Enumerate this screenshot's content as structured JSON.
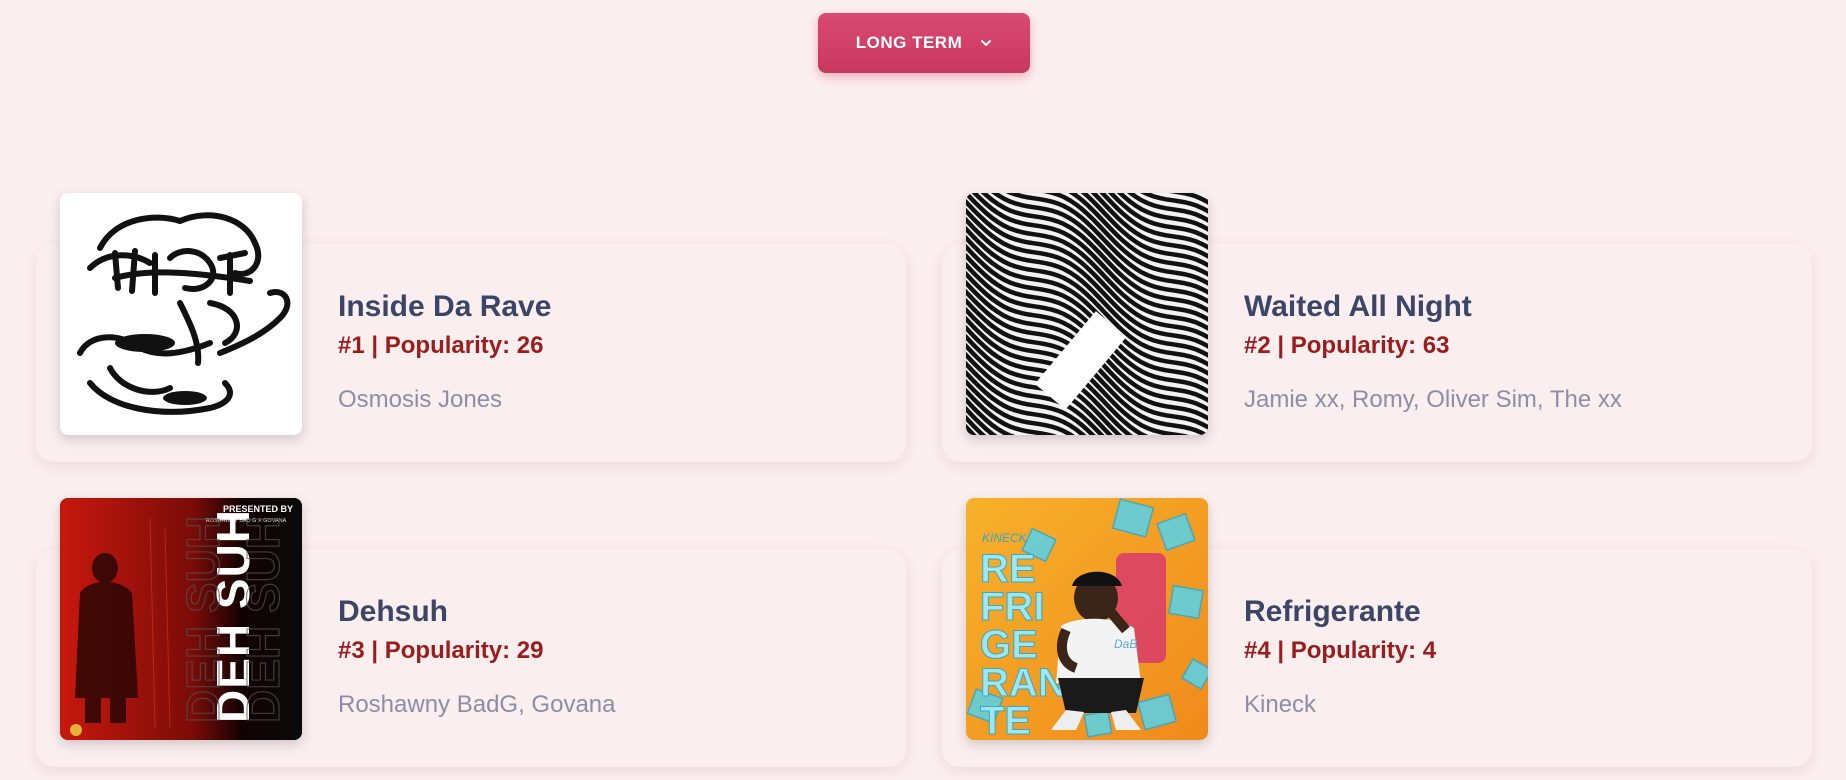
{
  "time_range": {
    "label": "LONG TERM",
    "icon": "chevron-down-icon"
  },
  "tracks": [
    {
      "title": "Inside Da Rave",
      "rank_text": "#1 | Popularity: 26",
      "artists": "Osmosis Jones",
      "cover_icon": "graffiti-cover"
    },
    {
      "title": "Waited All Night",
      "rank_text": "#2 | Popularity: 63",
      "artists": "Jamie xx, Romy, Oliver Sim, The xx",
      "cover_icon": "wave-pattern-cover"
    },
    {
      "title": "Dehsuh",
      "rank_text": "#3 | Popularity: 29",
      "artists": "Roshawny BadG, Govana",
      "cover_icon": "dehsuh-cover",
      "cover_text": {
        "top": "PRESENTED BY",
        "credit": "ROSHAWNY BAD G X GOVANA",
        "big": "DEH SUH"
      }
    },
    {
      "title": "Refrigerante",
      "rank_text": "#4 | Popularity: 4",
      "artists": "Kineck",
      "cover_icon": "refrigerante-cover",
      "cover_text": {
        "artist": "KINECK",
        "big": "REFRIGERANTE"
      }
    }
  ],
  "colors": {
    "background": "#fcefef",
    "button": "#d0406a",
    "title": "#3b4566",
    "rank": "#9b1c1c",
    "artist": "#8a8fa6"
  }
}
